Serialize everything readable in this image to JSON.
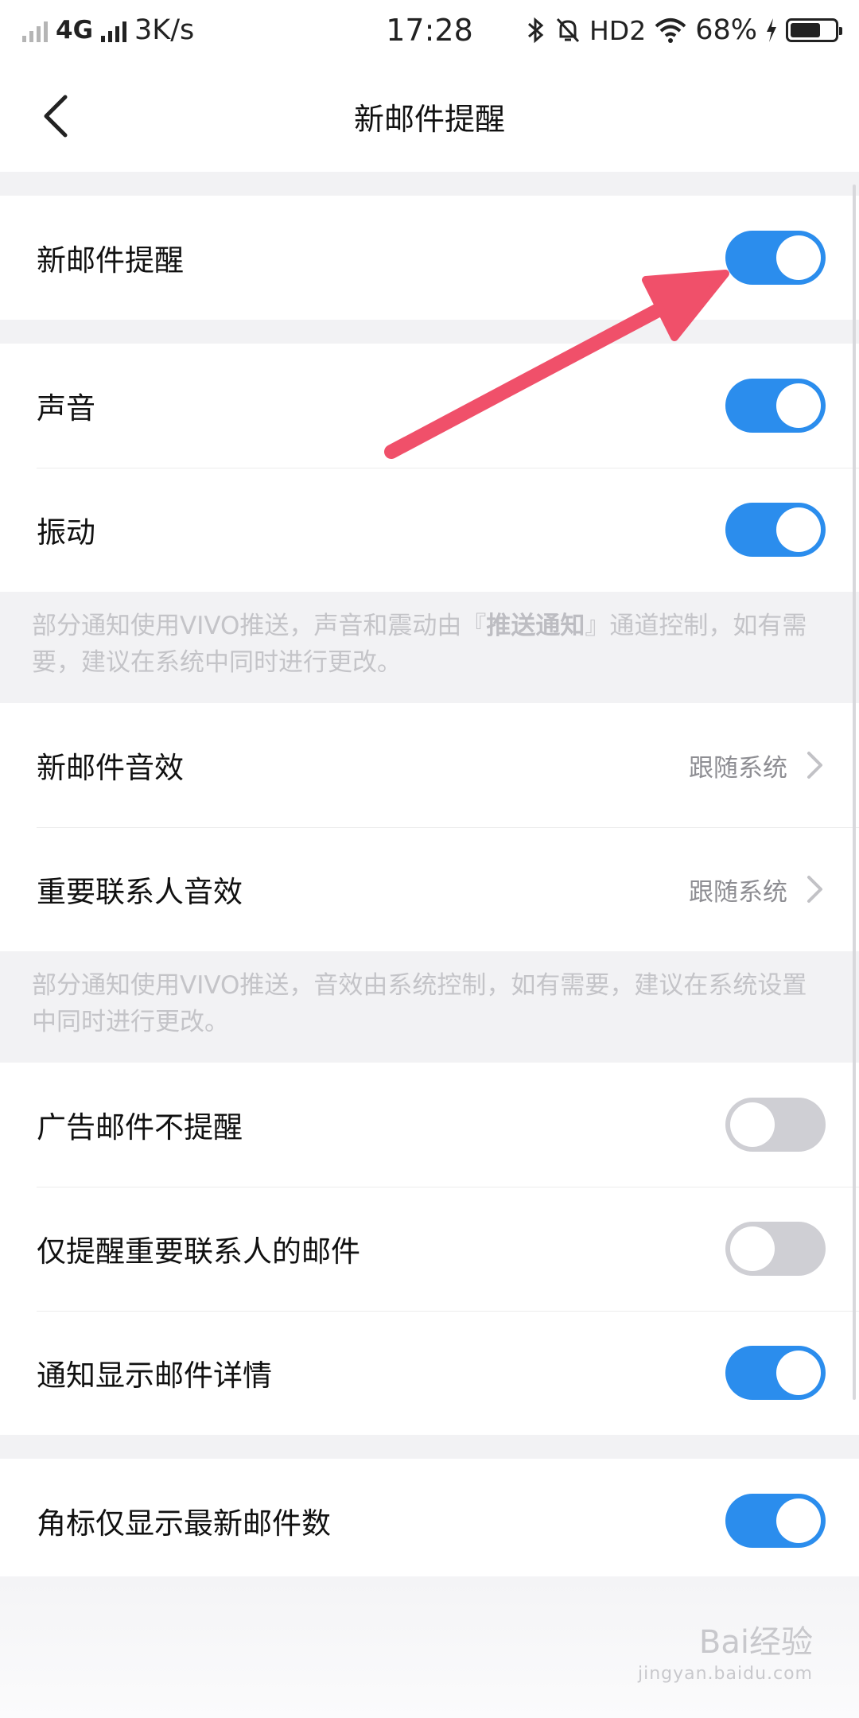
{
  "status_bar": {
    "network": "4G",
    "speed": "3K/s",
    "time": "17:28",
    "hd": "HD2",
    "battery": "68%",
    "battery_level": 0.68
  },
  "header": {
    "title": "新邮件提醒"
  },
  "settings": {
    "new_mail_alert": {
      "label": "新邮件提醒",
      "on": true
    },
    "sound": {
      "label": "声音",
      "on": true
    },
    "vibration": {
      "label": "振动",
      "on": true
    },
    "note1_part1": "部分通知使用VIVO推送，声音和震动由『",
    "note1_bold": "推送通知",
    "note1_part2": "』通道控制，如有需要，建议在系统中同时进行更改。",
    "new_mail_sound": {
      "label": "新邮件音效",
      "value": "跟随系统"
    },
    "vip_sound": {
      "label": "重要联系人音效",
      "value": "跟随系统"
    },
    "note2": "部分通知使用VIVO推送，音效由系统控制，如有需要，建议在系统设置中同时进行更改。",
    "ad_mail": {
      "label": "广告邮件不提醒",
      "on": false
    },
    "vip_only": {
      "label": "仅提醒重要联系人的邮件",
      "on": false
    },
    "show_details": {
      "label": "通知显示邮件详情",
      "on": true
    },
    "badge_latest": {
      "label": "角标仅显示最新邮件数",
      "on": true
    }
  },
  "watermark": {
    "brand": "Bai经验",
    "url": "jingyan.baidu.com"
  },
  "colors": {
    "accent": "#2b8ded",
    "annotation_arrow": "#f0506a"
  }
}
